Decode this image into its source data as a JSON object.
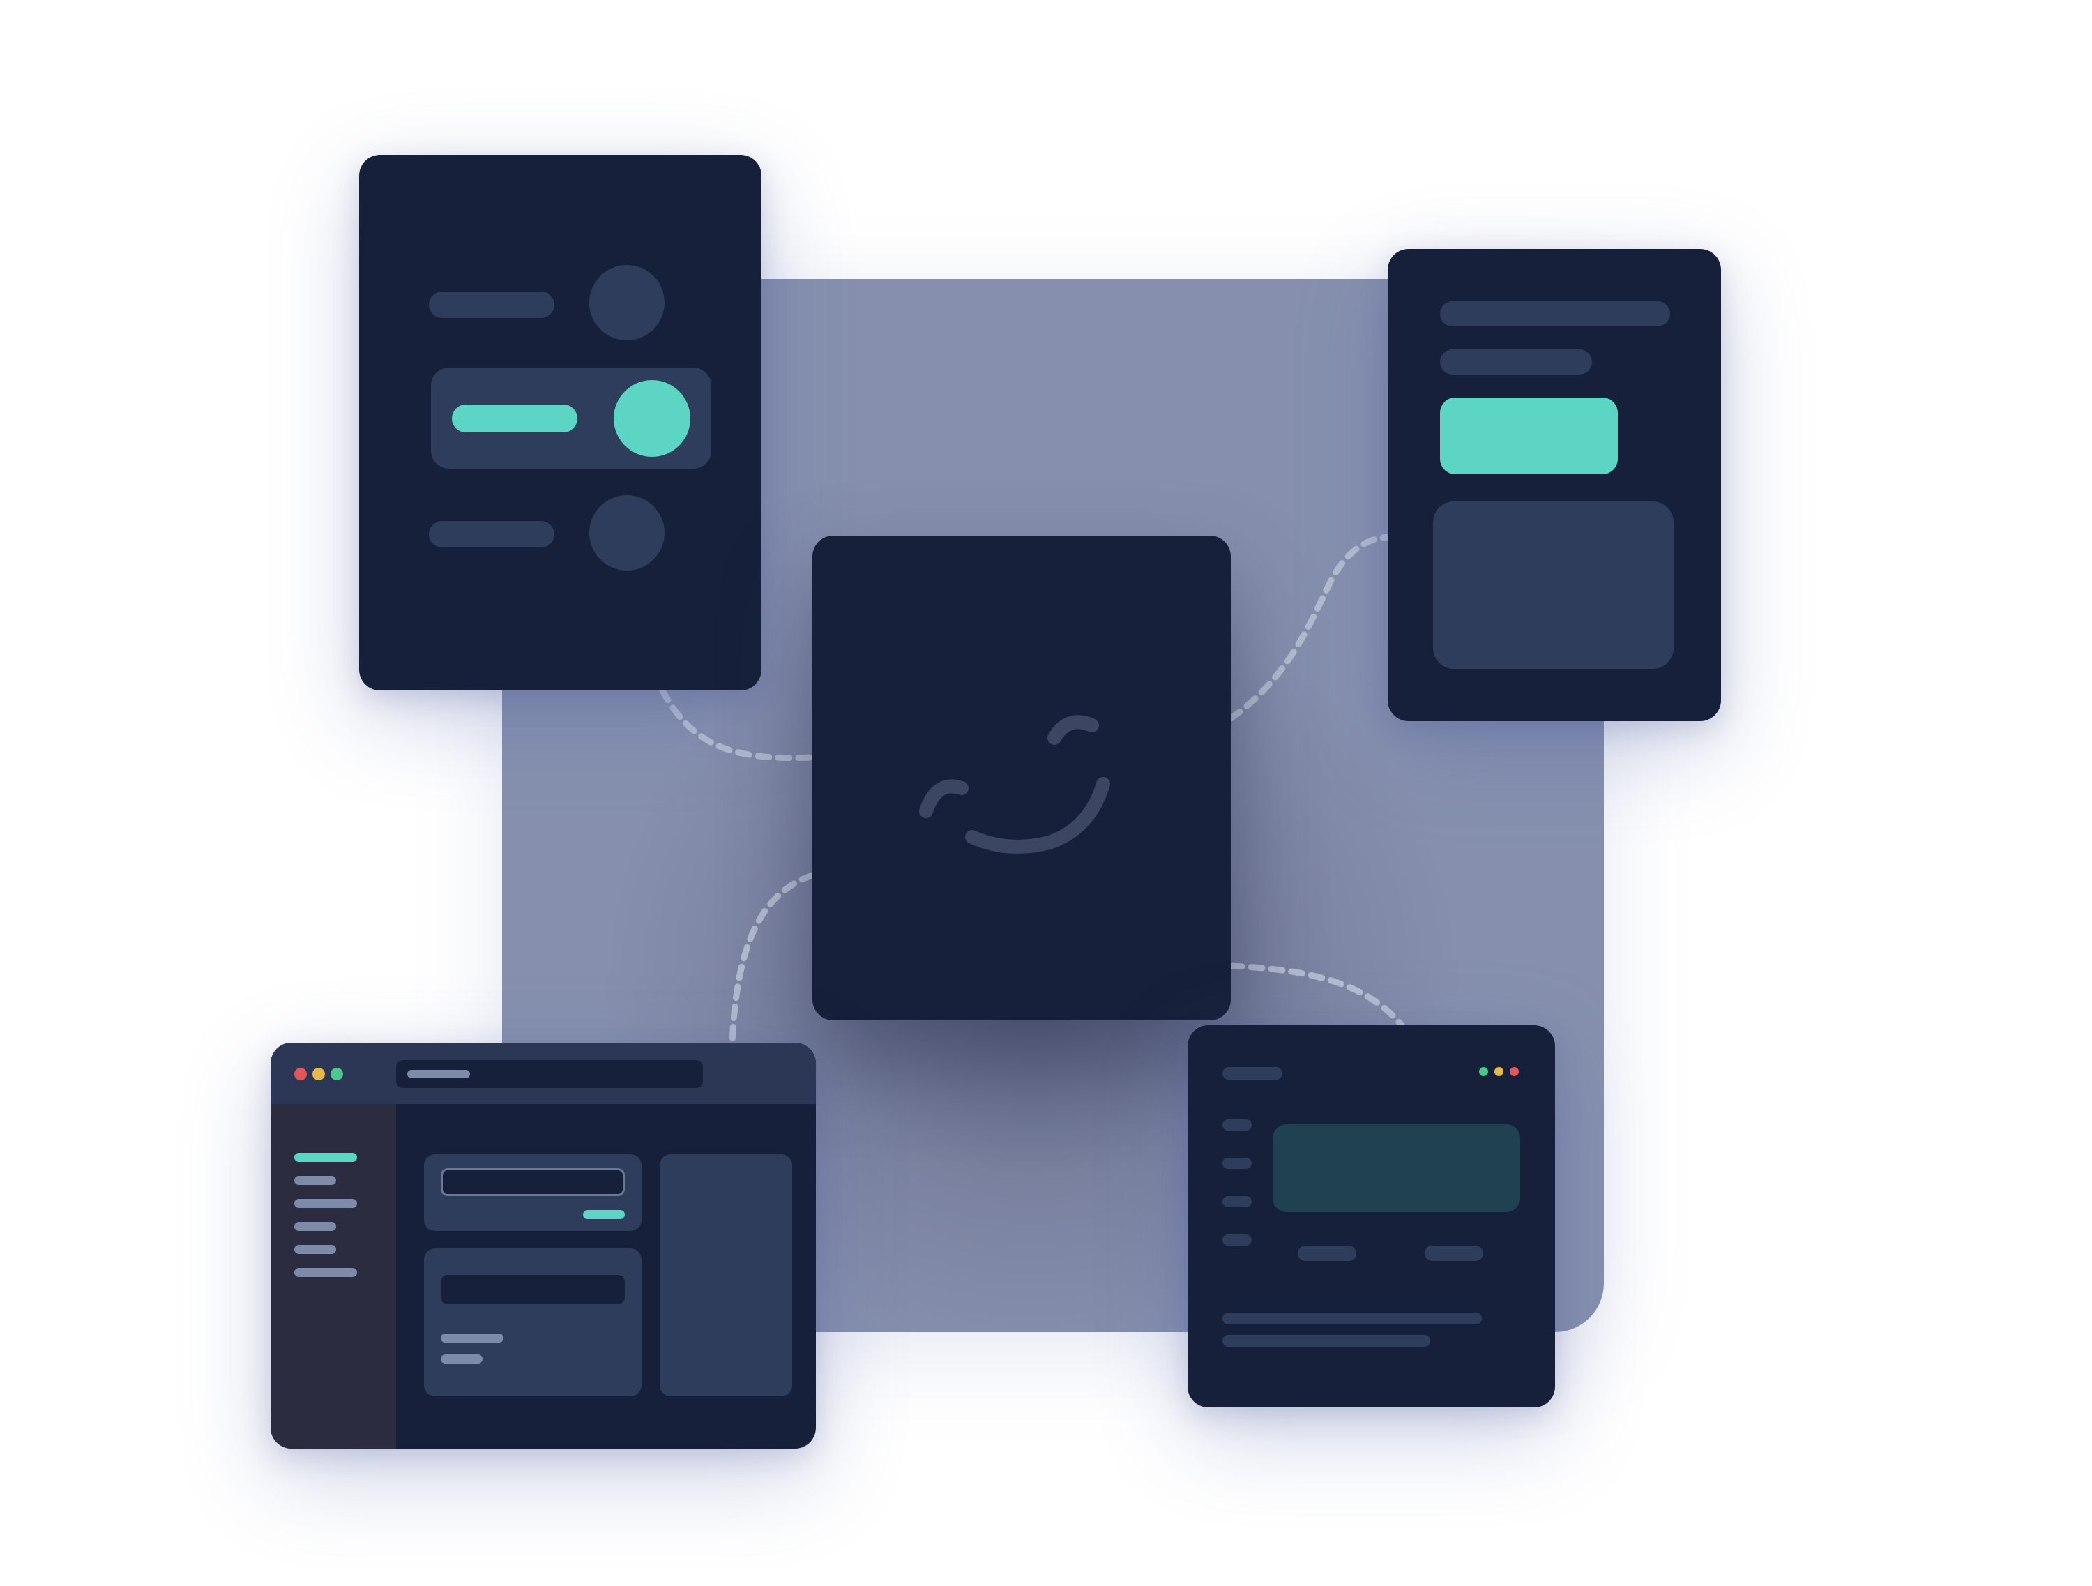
{
  "colors": {
    "panel_background": "#8690ae",
    "panel_glow": "#5b6280",
    "card_background": "#17203a",
    "skeleton": "#2f3d5c",
    "skeleton_light": "#7d8aa8",
    "accent": "#5dd5c4",
    "sidebar_background": "#2b2c40",
    "titlebar_background": "#2b3755",
    "dashed_connector": "#b3bccf",
    "face_stroke": "#3a4662",
    "dark_teal": "#1f4150",
    "traffic_red": "#e0585a",
    "traffic_yellow": "#e6b94a",
    "traffic_green": "#4fc78c"
  },
  "center_card": {
    "icon": "smiley-wink-icon"
  },
  "settings_card": {
    "rows": [
      {
        "state": "off"
      },
      {
        "state": "on",
        "highlighted": true
      },
      {
        "state": "off"
      }
    ]
  },
  "form_card": {
    "primary_button_icon": "accent-button"
  },
  "browser_window": {
    "window_controls": [
      "close-dot",
      "minimize-dot",
      "maximize-dot"
    ],
    "sidebar_items": 6,
    "active_sidebar_item": 0
  },
  "app_window": {
    "window_controls": [
      "green-dot",
      "yellow-dot",
      "red-dot"
    ],
    "nav_items": 4
  }
}
